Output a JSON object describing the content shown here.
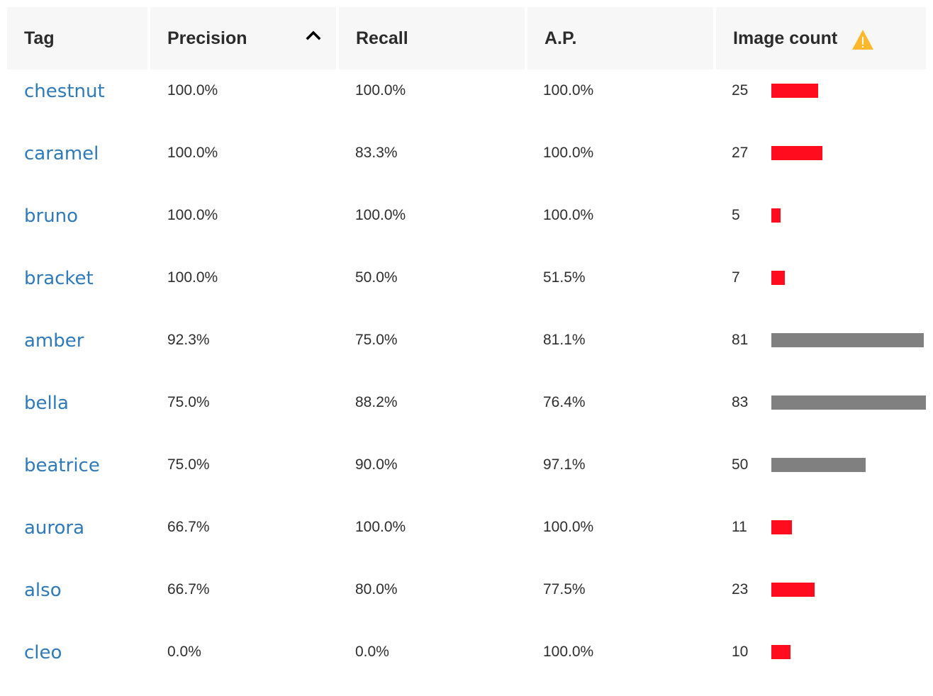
{
  "header": {
    "columns": [
      {
        "label": "Tag"
      },
      {
        "label": "Precision",
        "sort": "ascending",
        "sort_icon": "chevron-up-icon"
      },
      {
        "label": "Recall"
      },
      {
        "label": "A.P."
      },
      {
        "label": "Image count",
        "warning_icon": "warning-triangle-icon"
      }
    ]
  },
  "colors": {
    "link": "#2f7ab8",
    "bar_low": "#ff0d1f",
    "bar_ok": "#808080",
    "warning": "#ffb72b",
    "header_bg": "#f7f7f7"
  },
  "bar_scale_max": 83,
  "rows": [
    {
      "tag": "chestnut",
      "precision": "100.0%",
      "recall": "100.0%",
      "ap": "100.0%",
      "image_count": 25,
      "count_label": "25",
      "low": true
    },
    {
      "tag": "caramel",
      "precision": "100.0%",
      "recall": "83.3%",
      "ap": "100.0%",
      "image_count": 27,
      "count_label": "27",
      "low": true
    },
    {
      "tag": "bruno",
      "precision": "100.0%",
      "recall": "100.0%",
      "ap": "100.0%",
      "image_count": 5,
      "count_label": "5",
      "low": true
    },
    {
      "tag": "bracket",
      "precision": "100.0%",
      "recall": "50.0%",
      "ap": "51.5%",
      "image_count": 7,
      "count_label": "7",
      "low": true
    },
    {
      "tag": "amber",
      "precision": "92.3%",
      "recall": "75.0%",
      "ap": "81.1%",
      "image_count": 81,
      "count_label": "81",
      "low": false
    },
    {
      "tag": "bella",
      "precision": "75.0%",
      "recall": "88.2%",
      "ap": "76.4%",
      "image_count": 83,
      "count_label": "83",
      "low": false
    },
    {
      "tag": "beatrice",
      "precision": "75.0%",
      "recall": "90.0%",
      "ap": "97.1%",
      "image_count": 50,
      "count_label": "50",
      "low": false
    },
    {
      "tag": "aurora",
      "precision": "66.7%",
      "recall": "100.0%",
      "ap": "100.0%",
      "image_count": 11,
      "count_label": "11",
      "low": true
    },
    {
      "tag": "also",
      "precision": "66.7%",
      "recall": "80.0%",
      "ap": "77.5%",
      "image_count": 23,
      "count_label": "23",
      "low": true
    },
    {
      "tag": "cleo",
      "precision": "0.0%",
      "recall": "0.0%",
      "ap": "100.0%",
      "image_count": 10,
      "count_label": "10",
      "low": true
    }
  ]
}
